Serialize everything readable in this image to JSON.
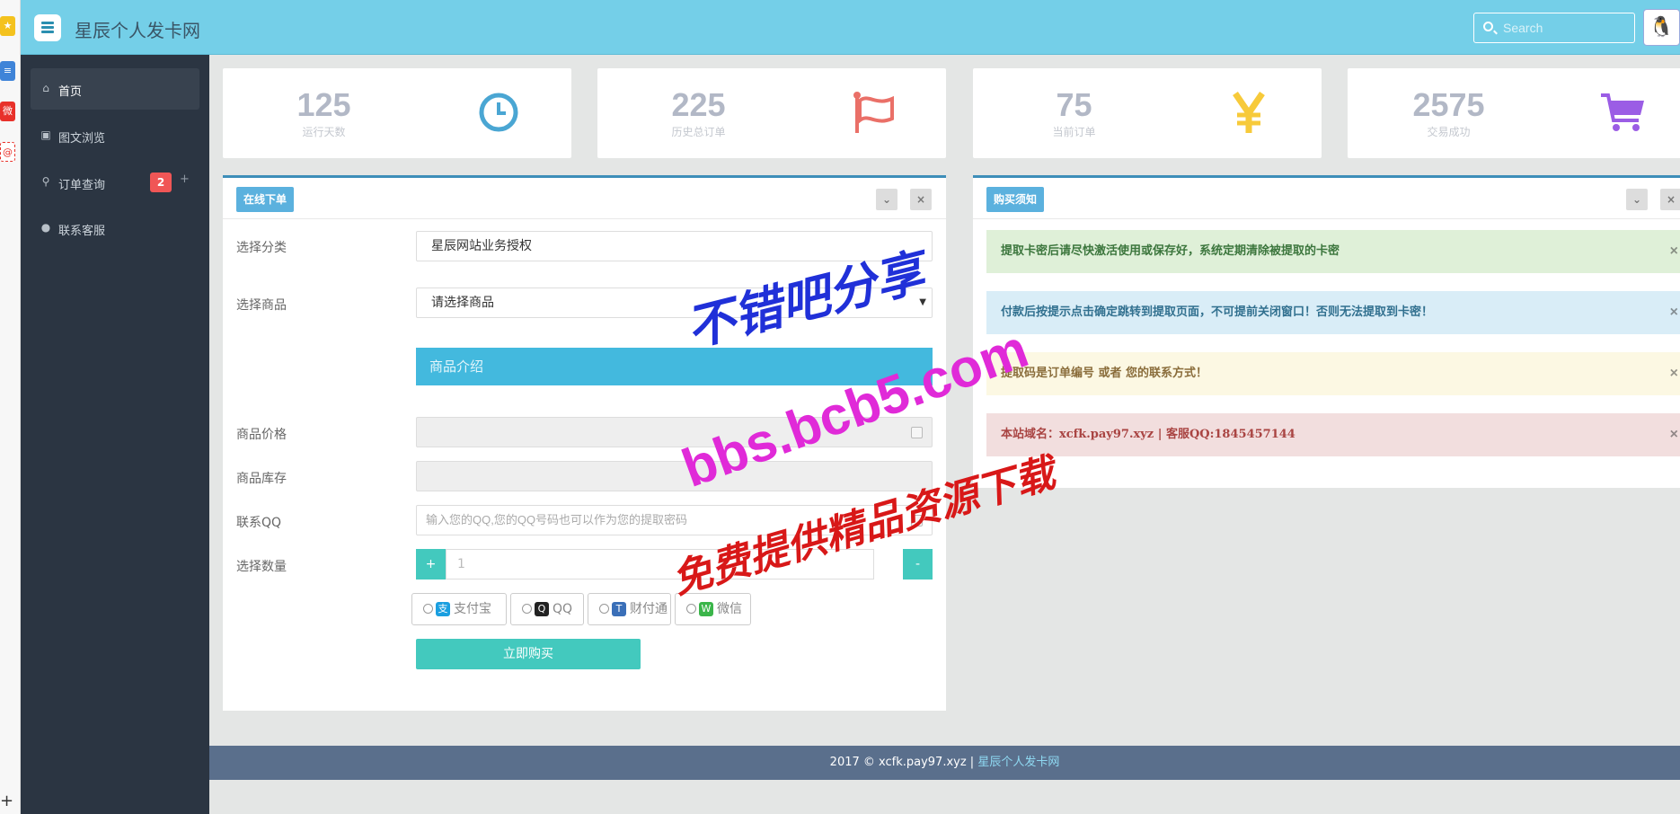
{
  "header": {
    "site_title": "星辰个人发卡网",
    "search_placeholder": "Search"
  },
  "sidebar": {
    "items": [
      {
        "label": "首页",
        "icon": "home-icon"
      },
      {
        "label": "图文浏览",
        "icon": "image-icon"
      },
      {
        "label": "订单查询",
        "icon": "search-icon",
        "badge": "2",
        "extra": "+"
      },
      {
        "label": "联系客服",
        "icon": "user-icon"
      }
    ]
  },
  "stats": [
    {
      "value": "125",
      "label": "运行天数",
      "icon": "clock-icon",
      "color": "#4aa6d3"
    },
    {
      "value": "225",
      "label": "历史总订单",
      "icon": "flag-icon",
      "color": "#ea7068"
    },
    {
      "value": "75",
      "label": "当前订单",
      "icon": "yen-icon",
      "color": "#f7ca3a"
    },
    {
      "value": "2575",
      "label": "交易成功",
      "icon": "cart-icon",
      "color": "#9b5de5"
    }
  ],
  "order_panel": {
    "title": "在线下单",
    "collapse": "⌄",
    "close": "×",
    "category_label": "选择分类",
    "category_value": "星辰网站业务授权",
    "product_label": "选择商品",
    "product_value": "请选择商品",
    "intro_label": "商品介绍",
    "price_label": "商品价格",
    "stock_label": "商品库存",
    "qq_label": "联系QQ",
    "qq_placeholder": "输入您的QQ,您的QQ号码也可以作为您的提取密码",
    "quantity_label": "选择数量",
    "quantity_plus": "+",
    "quantity_value": "1",
    "quantity_minus": "-",
    "payments": [
      {
        "label": "支付宝",
        "icon": "alipay-icon",
        "color": "#1a9fe0"
      },
      {
        "label": "QQ",
        "icon": "qq-icon",
        "color": "#222222"
      },
      {
        "label": "财付通",
        "icon": "tenpay-icon",
        "color": "#3a6fb8"
      },
      {
        "label": "微信",
        "icon": "wechat-icon",
        "color": "#3bb54a"
      }
    ],
    "buy_label": "立即购买"
  },
  "notice_panel": {
    "title": "购买须知",
    "collapse": "⌄",
    "close": "×",
    "alerts": [
      {
        "type": "success",
        "text": "提取卡密后请尽快激活使用或保存好，系统定期清除被提取的卡密"
      },
      {
        "type": "info",
        "text": "付款后按提示点击确定跳转到提取页面，不可提前关闭窗口！否则无法提取到卡密！"
      },
      {
        "type": "warning",
        "text": "提取码是订单编号 或者 您的联系方式！"
      },
      {
        "type": "danger",
        "text": "本站域名：xcfk.pay97.xyz | 客服QQ:1845457144"
      }
    ]
  },
  "footer": {
    "copyright": "2017 © xcfk.pay97.xyz | ",
    "link": "星辰个人发卡网"
  },
  "watermark": {
    "line1": "不错吧分享",
    "line2": "bbs.bcb5.com",
    "line3": "免费提供精品资源下载"
  }
}
